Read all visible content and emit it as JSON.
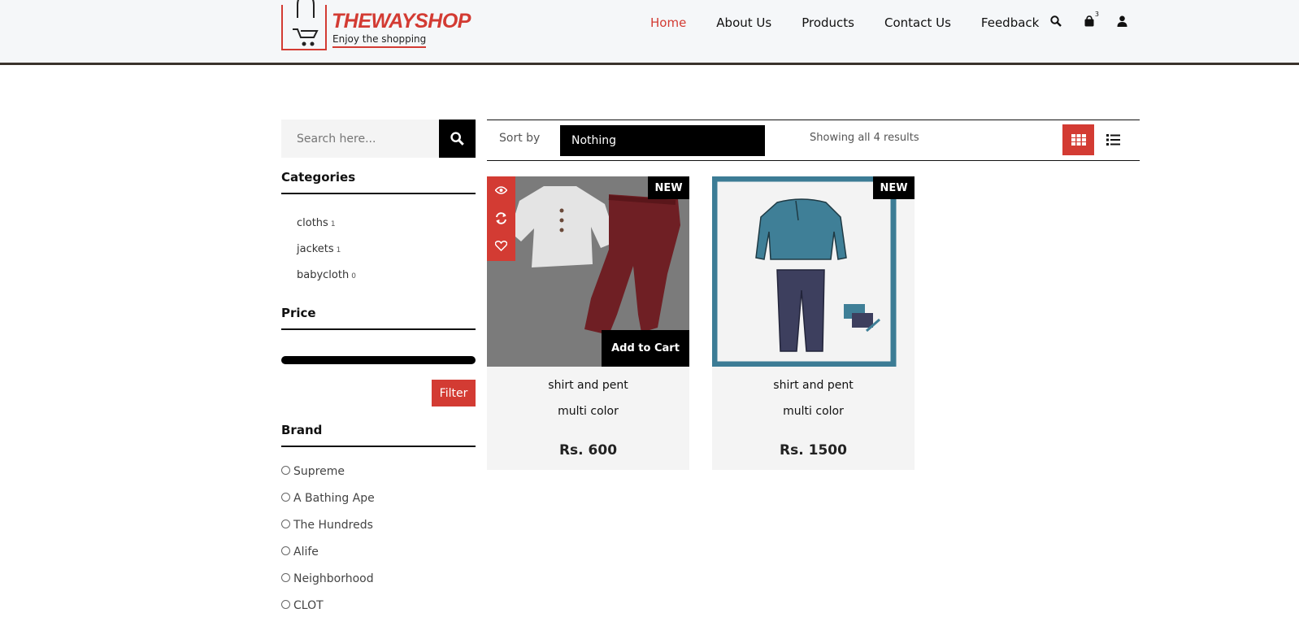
{
  "header": {
    "logo_title": "THEWAYSHOP",
    "logo_tagline": "Enjoy the shopping",
    "nav": [
      "Home",
      "About Us",
      "Products",
      "Contact Us",
      "Feedback"
    ],
    "active_nav": "Home",
    "cart_count": "3",
    "icons": [
      "search-icon",
      "shopping-bag-icon",
      "user-icon"
    ]
  },
  "sidebar": {
    "search_placeholder": "Search here...",
    "categories_heading": "Categories",
    "categories": [
      {
        "label": "cloths",
        "count": "1"
      },
      {
        "label": "jackets",
        "count": "1"
      },
      {
        "label": "babycloth",
        "count": "0"
      }
    ],
    "price_heading": "Price",
    "filter_label": "Filter",
    "brand_heading": "Brand",
    "brands": [
      "Supreme",
      "A Bathing Ape",
      "The Hundreds",
      "Alife",
      "Neighborhood",
      "CLOT"
    ]
  },
  "toolbar": {
    "sort_label": "Sort by",
    "sort_value": "Nothing",
    "results_text": "Showing all 4 results"
  },
  "products": [
    {
      "badge": "NEW",
      "name": "shirt and pent",
      "color": "multi color",
      "price": "Rs. 600",
      "add_to_cart": "Add to Cart"
    },
    {
      "badge": "NEW",
      "name": "shirt and pent",
      "color": "multi color",
      "price": "Rs. 1500"
    }
  ],
  "colors": {
    "accent": "#d33b33",
    "header_bg": "#f5f7f9",
    "card_bg": "#f4f4f4",
    "product2_frame": "#3c7c95"
  }
}
